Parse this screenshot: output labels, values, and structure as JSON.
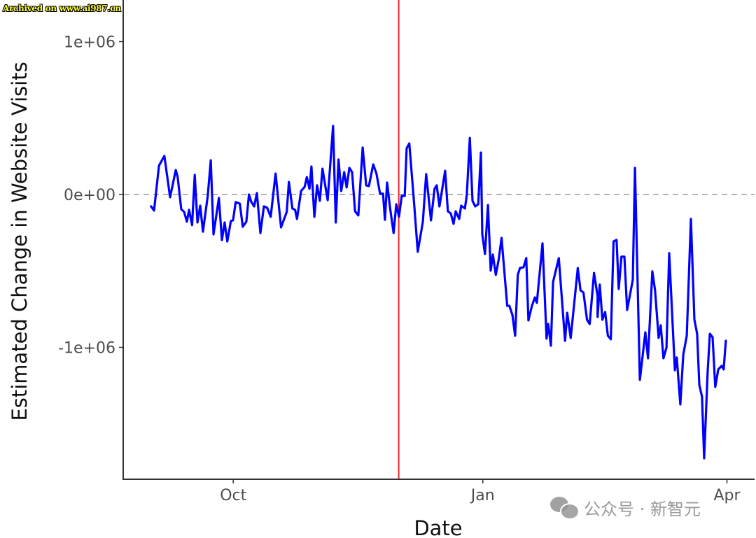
{
  "watermark_top": "Archived on www.ai987.cn",
  "watermark_bottom": "公众号 · 新智元",
  "chart_data": {
    "type": "line",
    "title": "",
    "xlabel": "Date",
    "ylabel": "Estimated Change in Website Visits",
    "x_start_date": "Sep 1",
    "x_unit": "days since Sep 1",
    "xlim_days": [
      -11,
      222
    ],
    "ylim": [
      -1870000,
      1260000
    ],
    "x_ticks": [
      {
        "label": "Oct",
        "day": 30
      },
      {
        "label": "Jan",
        "day": 122
      },
      {
        "label": "Apr",
        "day": 212
      }
    ],
    "y_ticks": [
      {
        "label": "1e+06",
        "value": 1000000
      },
      {
        "label": "0e+00",
        "value": 0
      },
      {
        "label": "-1e+06",
        "value": -1000000
      }
    ],
    "reference_lines": [
      {
        "type": "horizontal",
        "value": 0,
        "style": "dashed",
        "color": "#b3b3b3"
      },
      {
        "type": "vertical",
        "day": 91,
        "style": "solid",
        "color": "#e8262c"
      }
    ],
    "series": [
      {
        "name": "Estimated Change in Website Visits",
        "color": "#0000ff",
        "points_day_value": [
          [
            -0.3,
            -78000
          ],
          [
            0.8,
            -105000
          ],
          [
            2.6,
            188000
          ],
          [
            4.6,
            252000
          ],
          [
            6.7,
            -18000
          ],
          [
            8.8,
            160000
          ],
          [
            9.5,
            115000
          ],
          [
            10.8,
            -96000
          ],
          [
            11.9,
            -114000
          ],
          [
            12.9,
            -178000
          ],
          [
            13.7,
            -100000
          ],
          [
            14.8,
            -200000
          ],
          [
            15.8,
            128000
          ],
          [
            16.8,
            -183000
          ],
          [
            17.8,
            -73000
          ],
          [
            18.8,
            -243000
          ],
          [
            19.9,
            -100000
          ],
          [
            20.6,
            -9000
          ],
          [
            21.7,
            224000
          ],
          [
            22.7,
            -261000
          ],
          [
            24.7,
            -23000
          ],
          [
            25.8,
            -298000
          ],
          [
            26.8,
            -183000
          ],
          [
            27.8,
            -307000
          ],
          [
            29.1,
            -174000
          ],
          [
            29.9,
            -169000
          ],
          [
            30.9,
            -50000
          ],
          [
            32.4,
            -60000
          ],
          [
            33.5,
            -211000
          ],
          [
            34.8,
            -178000
          ],
          [
            35.8,
            0
          ],
          [
            36.6,
            -46000
          ],
          [
            37.7,
            -78000
          ],
          [
            38.7,
            9000
          ],
          [
            40,
            -252000
          ],
          [
            41.3,
            -78000
          ],
          [
            42.5,
            -87000
          ],
          [
            43.8,
            -146000
          ],
          [
            45.6,
            137000
          ],
          [
            47.6,
            -215000
          ],
          [
            49.7,
            -114000
          ],
          [
            50.5,
            82000
          ],
          [
            51.8,
            -91000
          ],
          [
            52.8,
            -101000
          ],
          [
            53.5,
            -160000
          ],
          [
            55,
            23000
          ],
          [
            56.3,
            50000
          ],
          [
            57.1,
            114000
          ],
          [
            58.1,
            37000
          ],
          [
            58.8,
            183000
          ],
          [
            59.9,
            -146000
          ],
          [
            60.9,
            60000
          ],
          [
            61.9,
            -41000
          ],
          [
            62.9,
            169000
          ],
          [
            64.8,
            -37000
          ],
          [
            66.8,
            448000
          ],
          [
            67.8,
            -183000
          ],
          [
            68.8,
            229000
          ],
          [
            69.8,
            23000
          ],
          [
            70.9,
            146000
          ],
          [
            71.8,
            46000
          ],
          [
            72.8,
            174000
          ],
          [
            73.8,
            146000
          ],
          [
            74.9,
            -110000
          ],
          [
            76.1,
            -137000
          ],
          [
            77.7,
            307000
          ],
          [
            79,
            60000
          ],
          [
            80,
            55000
          ],
          [
            81.6,
            197000
          ],
          [
            82.8,
            137000
          ],
          [
            84.1,
            5000
          ],
          [
            85.2,
            5000
          ],
          [
            85.9,
            -165000
          ],
          [
            86.7,
            78000
          ],
          [
            87.8,
            -87000
          ],
          [
            89.1,
            -252000
          ],
          [
            90.1,
            -64000
          ],
          [
            91.1,
            -146000
          ],
          [
            92.1,
            -9000
          ],
          [
            93.2,
            -9000
          ],
          [
            93.9,
            302000
          ],
          [
            94.9,
            334000
          ],
          [
            96.5,
            -18000
          ],
          [
            98,
            -375000
          ],
          [
            99.9,
            -178000
          ],
          [
            101.1,
            133000
          ],
          [
            102.9,
            -169000
          ],
          [
            104.2,
            37000
          ],
          [
            105,
            60000
          ],
          [
            106,
            -78000
          ],
          [
            108.1,
            155000
          ],
          [
            109.1,
            -110000
          ],
          [
            110.2,
            -124000
          ],
          [
            111.2,
            -192000
          ],
          [
            112,
            -110000
          ],
          [
            113.3,
            -160000
          ],
          [
            114,
            -73000
          ],
          [
            115.4,
            -91000
          ],
          [
            116.1,
            0
          ],
          [
            117.2,
            370000
          ],
          [
            118.2,
            -41000
          ],
          [
            119.2,
            -78000
          ],
          [
            120.3,
            -64000
          ],
          [
            121.3,
            274000
          ],
          [
            121.8,
            -261000
          ],
          [
            122.8,
            -389000
          ],
          [
            123.9,
            -69000
          ],
          [
            124.9,
            -498000
          ],
          [
            125.7,
            -393000
          ],
          [
            126.8,
            -526000
          ],
          [
            127.9,
            -421000
          ],
          [
            128.9,
            -284000
          ],
          [
            131,
            -728000
          ],
          [
            131.8,
            -728000
          ],
          [
            132.9,
            -787000
          ],
          [
            133.9,
            -924000
          ],
          [
            134.9,
            -526000
          ],
          [
            135.7,
            -481000
          ],
          [
            137,
            -476000
          ],
          [
            138,
            -416000
          ],
          [
            138.8,
            -824000
          ],
          [
            140.1,
            -728000
          ],
          [
            141.2,
            -673000
          ],
          [
            141.9,
            -709000
          ],
          [
            144,
            -320000
          ],
          [
            145.5,
            -943000
          ],
          [
            146.1,
            -847000
          ],
          [
            147.1,
            -989000
          ],
          [
            147.9,
            -572000
          ],
          [
            150,
            -416000
          ],
          [
            152.3,
            -957000
          ],
          [
            153.1,
            -774000
          ],
          [
            154.4,
            -939000
          ],
          [
            157,
            -481000
          ],
          [
            158,
            -627000
          ],
          [
            159.1,
            -641000
          ],
          [
            160.4,
            -819000
          ],
          [
            161.4,
            -847000
          ],
          [
            163,
            -513000
          ],
          [
            164.3,
            -664000
          ],
          [
            164.3,
            -801000
          ],
          [
            165.1,
            -590000
          ],
          [
            166.1,
            -819000
          ],
          [
            167.1,
            -769000
          ],
          [
            168.1,
            -924000
          ],
          [
            169.2,
            -947000
          ],
          [
            170.2,
            -307000
          ],
          [
            171.3,
            -297000
          ],
          [
            172.1,
            -618000
          ],
          [
            173.1,
            -407000
          ],
          [
            174.2,
            -407000
          ],
          [
            175.2,
            -755000
          ],
          [
            177.3,
            -558000
          ],
          [
            178.1,
            174000
          ],
          [
            179.9,
            -1213000
          ],
          [
            181.9,
            -902000
          ],
          [
            182.9,
            -1071000
          ],
          [
            184.5,
            -503000
          ],
          [
            185.5,
            -627000
          ],
          [
            186.8,
            -938000
          ],
          [
            187.6,
            -856000
          ],
          [
            188.6,
            -1071000
          ],
          [
            189.7,
            -1002000
          ],
          [
            190.7,
            -384000
          ],
          [
            192.8,
            -1149000
          ],
          [
            193.5,
            -1066000
          ],
          [
            194.8,
            -1373000
          ],
          [
            195.9,
            -1048000
          ],
          [
            197.2,
            -924000
          ],
          [
            198.7,
            -160000
          ],
          [
            200,
            -819000
          ],
          [
            201,
            -911000
          ],
          [
            201.8,
            -1245000
          ],
          [
            202.8,
            -1323000
          ],
          [
            203.6,
            -1726000
          ],
          [
            204.9,
            -1153000
          ],
          [
            205.7,
            -911000
          ],
          [
            206.7,
            -934000
          ],
          [
            207.7,
            -1259000
          ],
          [
            208.8,
            -1144000
          ],
          [
            210.1,
            -1121000
          ],
          [
            210.8,
            -1144000
          ],
          [
            211.6,
            -957000
          ]
        ]
      }
    ]
  }
}
